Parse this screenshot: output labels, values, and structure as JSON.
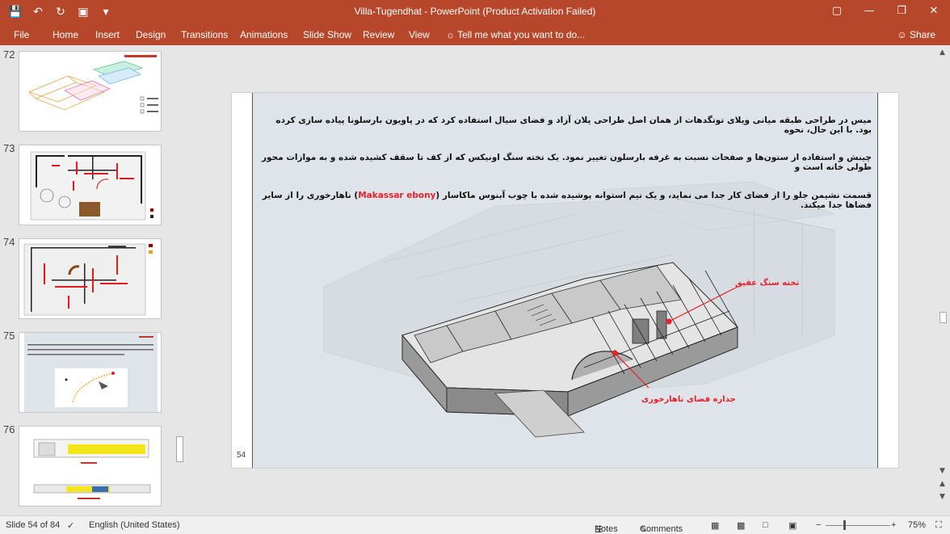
{
  "window": {
    "title": "Villa-Tugendhat - PowerPoint (Product Activation Failed)",
    "share_label": "Share"
  },
  "ribbon": {
    "file": "File",
    "tabs": [
      "Home",
      "Insert",
      "Design",
      "Transitions",
      "Animations",
      "Slide Show",
      "Review",
      "View"
    ],
    "tell_me": "Tell me what you want to do..."
  },
  "thumbnails": [
    {
      "number": "72"
    },
    {
      "number": "73"
    },
    {
      "number": "74"
    },
    {
      "number": "75"
    },
    {
      "number": "76"
    }
  ],
  "slide": {
    "number": "54",
    "paragraph_lines": [
      "میس در طراحی طبقه میانی ویلای توتگدهات از همان اصل طراحی پلان آزاد و فضای سیال استفاده کرد که در پاویون بارسلونا پیاده سازی کرده بود. با این حال، نحوه",
      "چینش و استفاده از ستون‌ها و صفحات نسبت به غرفه بارسلون تغییر نمود. یک تخته سنگ اونیکس که از کف تا سقف کشیده شده و به موازات محور طولی خانه است و",
      "قسمت نشیمن جلو را از فضای کار جدا می نماید، و یک نیم استوانه پوشیده شده با چوب آبنوس ماکاسار ("
    ],
    "highlight": "Makassar ebony",
    "paragraph_tail": ") ناهارخوری را از سایر فضاها جدا میکند.",
    "label_stone": "تخته سنگ عقیق",
    "label_dining": "جداره فضای ناهارخوری"
  },
  "status": {
    "slide_of": "Slide 54 of 84",
    "language": "English (United States)",
    "notes": "Notes",
    "comments": "Comments",
    "zoom": "75%"
  },
  "colors": {
    "accent": "#b7472a",
    "label_red": "#e8202a"
  }
}
